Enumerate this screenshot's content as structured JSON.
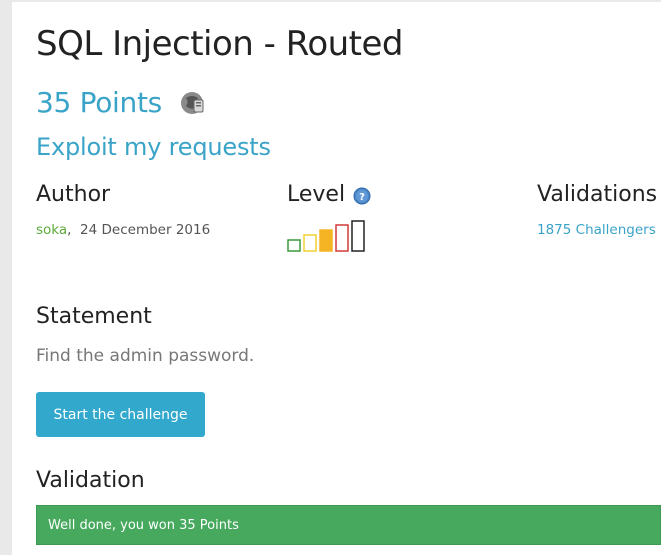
{
  "challenge": {
    "title": "SQL Injection - Routed",
    "points": "35 Points",
    "subtitle": "Exploit my requests"
  },
  "info": {
    "author_heading": "Author",
    "author_name": "soka",
    "author_separator": ",",
    "author_date": "24 December 2016",
    "level_heading": "Level",
    "level_value": 3,
    "level_max": 5,
    "level_colors": [
      "#3a9a3a",
      "#f0d232",
      "#f5b423",
      "#d23a3a",
      "#222222"
    ],
    "validations_heading": "Validations",
    "validations_value": "1875 Challengers"
  },
  "statement": {
    "heading": "Statement",
    "text": "Find the admin password.",
    "start_button": "Start the challenge"
  },
  "validation": {
    "heading": "Validation",
    "message": "Well done, you won 35 Points"
  },
  "icons": {
    "points_badge": "web-server-category-icon",
    "level_help": "question-circle-icon"
  }
}
